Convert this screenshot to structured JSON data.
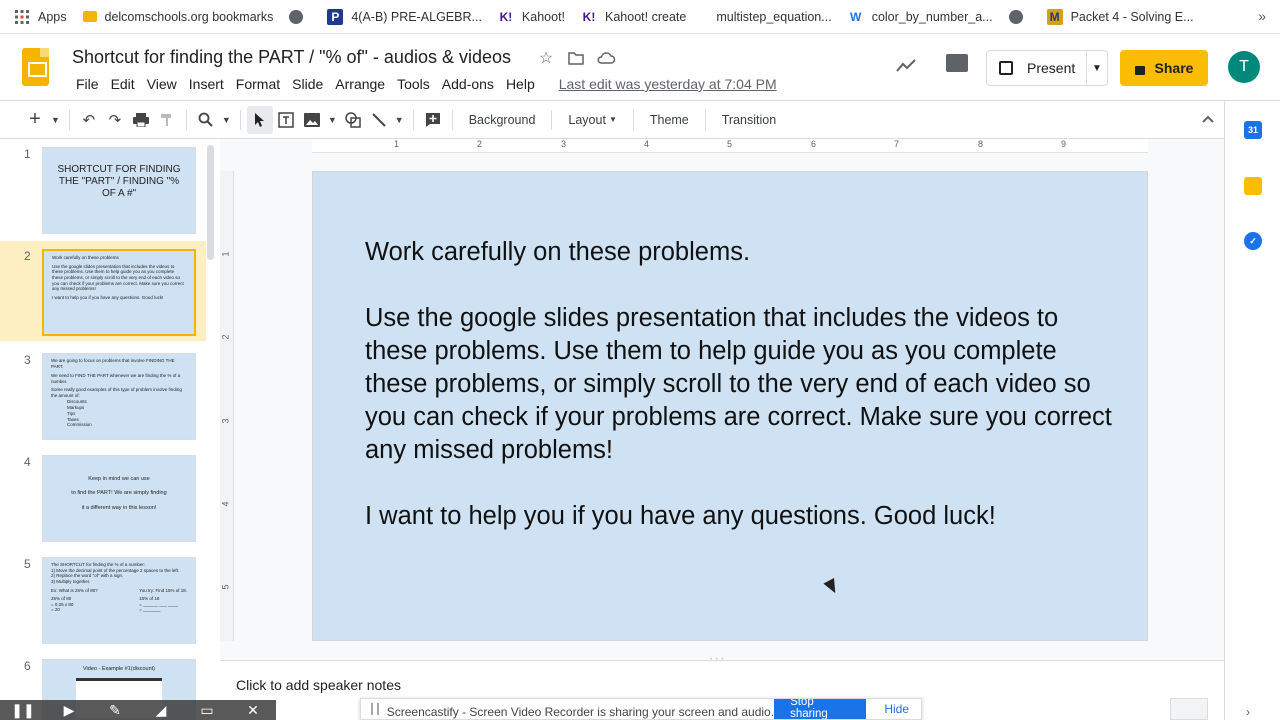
{
  "bookmarks": [
    {
      "label": "Apps",
      "icon": "apps-grid-icon",
      "color": "#4285f4"
    },
    {
      "label": "delcomschools.org bookmarks",
      "icon": "folder-icon",
      "color": "#f4b400"
    },
    {
      "label": "",
      "icon": "globe-icon",
      "color": "#5f6368"
    },
    {
      "label": "4(A-B) PRE-ALGEBR...",
      "icon": "p-badge-icon",
      "color": "#1e3a8a"
    },
    {
      "label": "Kahoot!",
      "icon": "kahoot-icon",
      "color": "#46178f"
    },
    {
      "label": "Kahoot! create",
      "icon": "kahoot-icon",
      "color": "#46178f"
    },
    {
      "label": "multistep_equation...",
      "icon": "blank-icon",
      "color": "#ffffff"
    },
    {
      "label": "color_by_number_a...",
      "icon": "w-logo-icon",
      "color": "#1a73e8"
    },
    {
      "label": "",
      "icon": "globe-icon",
      "color": "#5f6368"
    },
    {
      "label": "Packet 4 - Solving E...",
      "icon": "m-logo-icon",
      "color": "#d4a017"
    }
  ],
  "header": {
    "title": "Shortcut for finding the PART / \"% of\"  - audios & videos",
    "menus": [
      "File",
      "Edit",
      "View",
      "Insert",
      "Format",
      "Slide",
      "Arrange",
      "Tools",
      "Add-ons",
      "Help"
    ],
    "last_edit": "Last edit was yesterday at 7:04 PM",
    "present_label": "Present",
    "share_label": "Share",
    "avatar_initial": "T",
    "accent_color": "#fbbc04"
  },
  "toolbar": {
    "background_label": "Background",
    "layout_label": "Layout",
    "theme_label": "Theme",
    "transition_label": "Transition"
  },
  "ruler": {
    "h_ticks": [
      "1",
      "2",
      "3",
      "4",
      "5",
      "6",
      "7",
      "8",
      "9"
    ],
    "v_ticks": [
      "1",
      "2",
      "3",
      "4",
      "5"
    ]
  },
  "filmstrip": {
    "slides": [
      {
        "num": "1",
        "title": "SHORTCUT FOR FINDING THE \"PART\" / FINDING \"% OF A #\""
      },
      {
        "num": "2",
        "lines": [
          "Work carefully on these problems",
          "Use the google slides presentation that includes the videos to these problems. Use them to help guide you as you complete these problems, or simply scroll to the very end of each video so you can check if your problems are correct. Make sure you correct any missed problems!",
          "I want to help you if you have any questions. Good luck!"
        ]
      },
      {
        "num": "3",
        "lines": [
          "We are going to focus on problems that involve FINDING THE PART.",
          "We need to FIND THE PART whenever we are finding the % of a number.",
          "Some really good examples of this type of problem involve finding the amount of:",
          "Discounts",
          "Markups",
          "Tips",
          "Taxes",
          "Commission"
        ]
      },
      {
        "num": "4",
        "lines": [
          "Keep in mind we can use",
          "to find the PART! We are simply finding",
          "it a different way in this lesson!"
        ]
      },
      {
        "num": "5",
        "lines": [
          "The SHORTCUT for finding the % of a number:",
          "1) Move the decimal point of the percentage 2 spaces to the left.",
          "2) Replace the word \"of\" with a sign.",
          "3) Multiply together.",
          "Ex: What is 25% of 80?",
          "You try: Find 15% of 18.",
          "25% of 80",
          "= 0.25 x 80",
          "= 20",
          "15% of 18",
          "= ______ ___ ____",
          "= _______"
        ]
      },
      {
        "num": "6",
        "title": "Video - Example #1(discount)"
      }
    ]
  },
  "slide": {
    "paragraphs": [
      "Work carefully on these problems.",
      "Use the google slides presentation that includes the videos to these problems.  Use them to help guide you as you complete these problems, or simply scroll to the very end of each video so you can check if your problems are correct.  Make sure you correct any missed problems!",
      "I want to help you if you have any questions.  Good luck!"
    ],
    "background_color": "#cfe2f3"
  },
  "notes": {
    "placeholder": "Click to add speaker notes"
  },
  "screencastify": {
    "message": "Screencastify - Screen Video Recorder is sharing your screen and audio.",
    "stop_label": "Stop sharing",
    "hide_label": "Hide"
  }
}
